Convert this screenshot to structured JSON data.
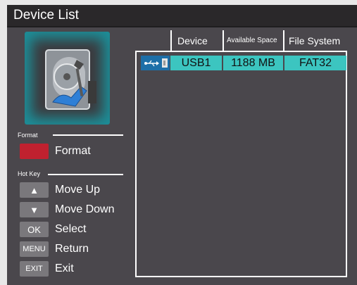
{
  "window": {
    "title": "Device List"
  },
  "sections": {
    "format": "Format",
    "hotkey": "Hot Key"
  },
  "format_action": {
    "label": "Format"
  },
  "hotkeys": [
    {
      "key": "▲",
      "label": "Move Up"
    },
    {
      "key": "▼",
      "label": "Move Down"
    },
    {
      "key": "OK",
      "label": "Select"
    },
    {
      "key": "MENU",
      "label": "Return"
    },
    {
      "key": "EXIT",
      "label": "Exit"
    }
  ],
  "table": {
    "headers": [
      "Device",
      "Available Space",
      "File System"
    ],
    "rows": [
      {
        "icon": "usb-drive-icon",
        "device": "USB1",
        "space": "1188 MB",
        "fs": "FAT32"
      }
    ]
  },
  "colors": {
    "accent": "#3cc5c0",
    "format_button": "#c0212f",
    "background": "#4a474c",
    "titlebar": "#2a282a"
  }
}
